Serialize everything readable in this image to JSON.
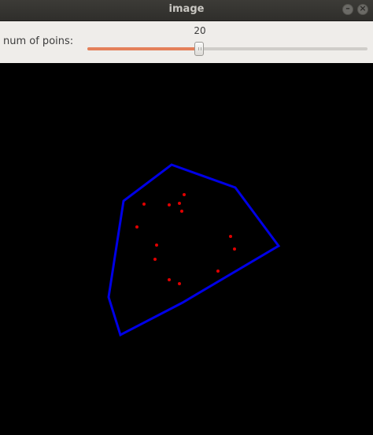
{
  "window": {
    "title": "image"
  },
  "toolbar": {
    "slider_label": "num of poins:",
    "slider_value": "20",
    "slider_fraction": 0.4
  },
  "plot": {
    "hull_color": "#0000e6",
    "point_color": "#e00000"
  }
}
